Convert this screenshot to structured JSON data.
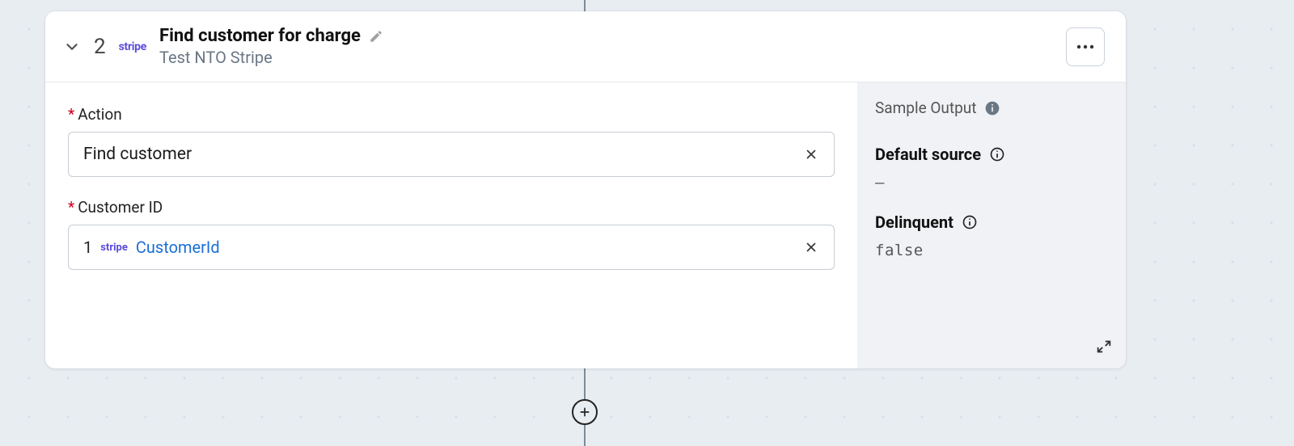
{
  "step": {
    "number": "2",
    "connector_badge": "stripe",
    "title": "Find customer for charge",
    "subtitle": "Test NTO Stripe"
  },
  "form": {
    "action": {
      "label": "Action",
      "value": "Find customer"
    },
    "customer_id": {
      "label": "Customer ID",
      "ref": {
        "step": "1",
        "connector": "stripe",
        "field": "CustomerId"
      }
    }
  },
  "sample": {
    "title": "Sample Output",
    "default_source": {
      "label": "Default source",
      "value": "–"
    },
    "delinquent": {
      "label": "Delinquent",
      "value": "false"
    }
  }
}
